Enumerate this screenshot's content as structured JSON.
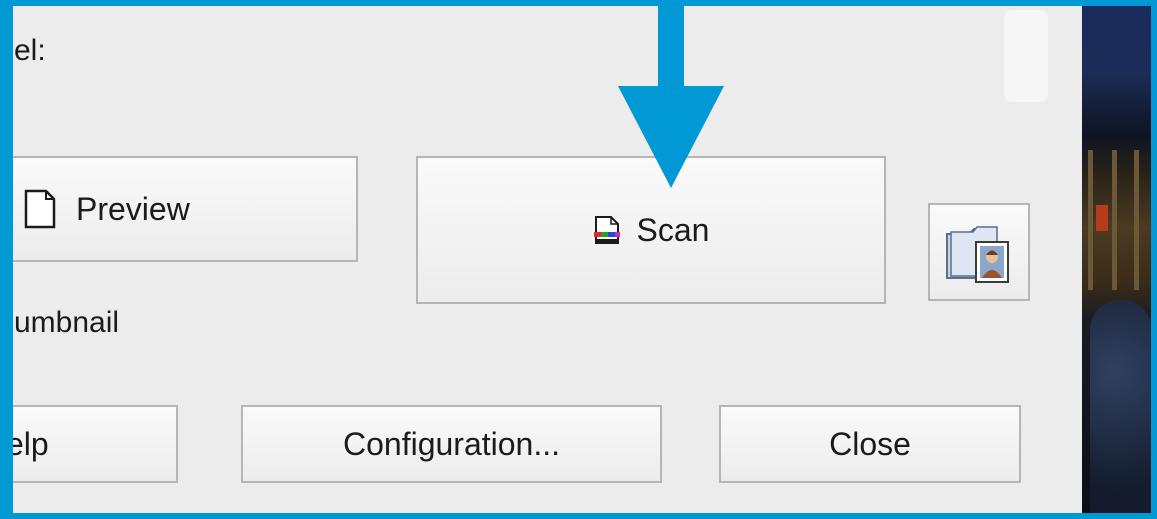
{
  "dialog": {
    "top_label": "el:",
    "thumbnail_label": "umbnail",
    "preview_button": {
      "label": "Preview",
      "icon": "document-icon"
    },
    "scan_button": {
      "label": "Scan",
      "icon": "scan-icon"
    },
    "folder_button": {
      "icon": "folder-photo-icon"
    },
    "help_button": {
      "label": "elp"
    },
    "configuration_button": {
      "label": "Configuration..."
    },
    "close_button": {
      "label": "Close"
    }
  },
  "annotation": {
    "arrow": "down-arrow-icon",
    "color": "#0099d6"
  },
  "colors": {
    "frame": "#0099d6",
    "panel_background": "#ececec",
    "button_border": "#b5b5b5"
  }
}
